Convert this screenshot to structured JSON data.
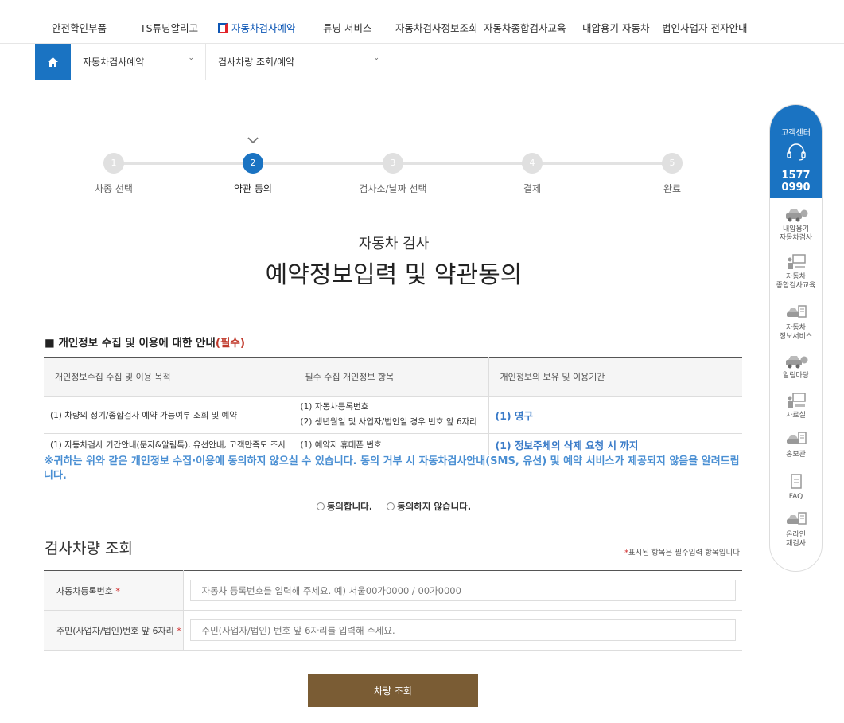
{
  "topnav": {
    "items": [
      "안전확인부품",
      "TS튜닝알리고",
      "자동차검사예약",
      "튜닝 서비스",
      "자동차검사정보조회",
      "자동차종합검사교육",
      "내압용기 자동차",
      "법인사업자 전자안내"
    ]
  },
  "breadcrumb": {
    "menu1": "자동차검사예약",
    "menu2": "검사차량 조회/예약"
  },
  "steps": [
    {
      "num": "1",
      "label": "차종 선택"
    },
    {
      "num": "2",
      "label": "약관 동의"
    },
    {
      "num": "3",
      "label": "검사소/날짜 선택"
    },
    {
      "num": "4",
      "label": "결제"
    },
    {
      "num": "5",
      "label": "완료"
    }
  ],
  "page": {
    "subtitle": "자동차 검사",
    "title": "예약정보입력 및 약관동의"
  },
  "privacy": {
    "heading": "■ 개인정보 수집 및 이용에 대한 안내",
    "heading_req": "(필수)",
    "headers": [
      "개인정보수집 수집 및 이용 목적",
      "필수 수집 개인정보 항목",
      "개인정보의 보유 및 이용기간"
    ],
    "row1": {
      "purpose": "(1) 차량의 정기/종합검사 예약 가능여부 조회 및 예약",
      "item1": "(1) 자동차등록번호",
      "item2": "(2) 생년월일 및 사업자/법인일 경우 번호 앞 6자리",
      "period": "(1) 영구"
    },
    "row2": {
      "purpose": "(1) 자동차검사 기간안내(문자&알림톡), 유선안내, 고객만족도 조사",
      "item": "(1) 예약자 휴대폰 번호",
      "period": "(1) 정보주체의 삭제 요청 시 까지"
    },
    "notice": "※귀하는 위와 같은 개인정보 수집·이용에 동의하지 않으실 수 있습니다. 동의 거부 시 자동차검사안내(SMS, 유선) 및 예약 서비스가 제공되지 않음을 알려드립니다.",
    "agree": "동의합니다.",
    "disagree": "동의하지 않습니다."
  },
  "vehicle": {
    "title": "검사차량 조회",
    "req_star": "*",
    "req_note": "표시된 항목은 필수입력 항목입니다.",
    "reg_label": "자동차등록번호",
    "reg_placeholder": "자동차 등록번호를 입력해 주세요. 예) 서울00가0000 / 00가0000",
    "id_label": "주민(사업자/법인)번호 앞 6자리",
    "id_placeholder": "주민(사업자/법인) 번호 앞 6자리를 입력해 주세요.",
    "button": "차량 조회"
  },
  "quickmenu": {
    "cc_title": "고객센터",
    "cc_num1": "1577",
    "cc_num2": "0990",
    "items": [
      {
        "l1": "내압용기",
        "l2": "자동차검사"
      },
      {
        "l1": "자동차",
        "l2": "종합검사교육"
      },
      {
        "l1": "자동차",
        "l2": "정보서비스"
      },
      {
        "l1": "알림마당",
        "l2": ""
      },
      {
        "l1": "자료실",
        "l2": ""
      },
      {
        "l1": "홍보관",
        "l2": ""
      },
      {
        "l1": "FAQ",
        "l2": ""
      },
      {
        "l1": "온라인",
        "l2": "재검사"
      }
    ]
  },
  "colors": {
    "primary": "#1a73c2",
    "button": "#7a5c34",
    "notice": "#4a8fd3",
    "required": "#d02a2a"
  }
}
